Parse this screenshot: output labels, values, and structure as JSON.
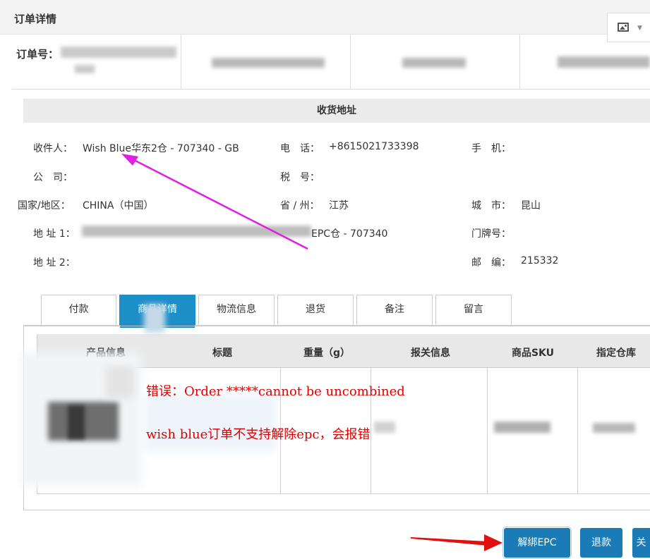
{
  "header": {
    "title": "订单详情",
    "image_button": "image-icon"
  },
  "order": {
    "number_label": "订单号："
  },
  "address": {
    "section_title": "收货地址",
    "recipient_label": "收件人：",
    "recipient_value": "Wish Blue华东2仓 - 707340 - GB",
    "phone_label": "电　话：",
    "phone_value": "+8615021733398",
    "mobile_label": "手　机：",
    "company_label": "公　司：",
    "tax_label": "税　号：",
    "country_label": "国家/地区：",
    "country_value": "CHINA（中国）",
    "province_label": "省 / 州：",
    "province_value": "江苏",
    "city_label": "城　市：",
    "city_value": "昆山",
    "address1_label": "地 址 1：",
    "address1_tail": "EPC仓 - 707340",
    "door_label": "门牌号：",
    "address2_label": "地 址 2：",
    "zip_label": "邮　编：",
    "zip_value": "215332"
  },
  "tabs": [
    {
      "label": "付款"
    },
    {
      "label": "商品详情"
    },
    {
      "label": "物流信息"
    },
    {
      "label": "退货"
    },
    {
      "label": "备注"
    },
    {
      "label": "留言"
    }
  ],
  "table": {
    "headers": [
      "产品信息",
      "标题",
      "重量（g）",
      "报关信息",
      "商品SKU",
      "指定仓库"
    ]
  },
  "annotation": {
    "line1": "错误：Order *****cannot be uncombined",
    "line2": "wish  blue订单不支持解除epc，会报错"
  },
  "buttons": {
    "unbind_epc": "解绑EPC",
    "refund": "退款",
    "close": "关"
  },
  "colors": {
    "accent": "#1d8fc8",
    "button": "#1a7bb7",
    "error": "#e00000",
    "arrow_magenta": "#e020e0",
    "arrow_red": "#e01010"
  }
}
